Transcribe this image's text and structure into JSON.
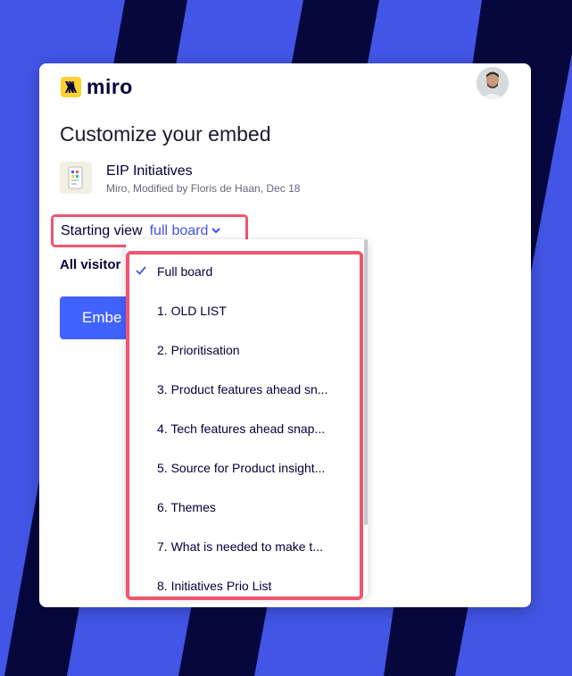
{
  "app": {
    "logo_text": "miro",
    "avatar_alt": "user avatar"
  },
  "embed": {
    "title": "Customize your embed",
    "board_name": "EIP Initiatives",
    "board_meta": "Miro, Modified by Floris de Haan, Dec 18",
    "starting_view_label": "Starting view",
    "starting_view_value": "full board",
    "visitors_label": "All visitor",
    "embed_button_label": "Embe"
  },
  "dropdown": {
    "selected_index": 0,
    "items": [
      "Full board",
      "1. OLD LIST",
      "2. Prioritisation",
      "3. Product features ahead sn...",
      "4. Tech features ahead snap...",
      "5. Source for Product insight...",
      "6. Themes",
      "7. What is needed to make t...",
      "8. Initiatives Prio List"
    ]
  },
  "colors": {
    "background": "#4255e6",
    "stripe": "#06073d",
    "accent": "#4262ff",
    "highlight": "#f0566f",
    "logo_yellow": "#ffd02f"
  },
  "icons": {
    "check": "check-icon",
    "chevron": "chevron-down-icon",
    "logo": "miro-logo-icon"
  }
}
